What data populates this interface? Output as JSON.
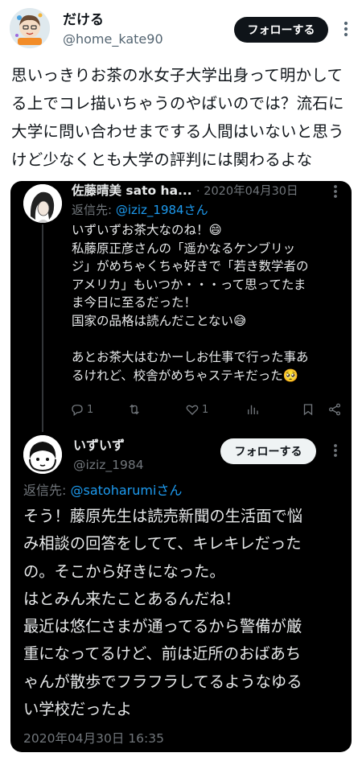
{
  "outer_tweet": {
    "author_name": "だける",
    "author_handle": "@home_kate90",
    "follow_label": "フォローする",
    "body": "思いっきりお茶の水女子大学出身って明かして\nる上でコレ描いちゃうのやばいのでは？流石に\n大学に問い合わせまでする人間はいないと思う\nけど少なくとも大学の評判には関わるよな"
  },
  "embedded_thread": {
    "first_reply": {
      "author_name": "佐藤晴美 sato ha...",
      "date": "· 2020年04月30日",
      "reply_prefix": "返信先: ",
      "reply_to": "@iziz_1984さん",
      "body": "いずいずお茶大なのね！😄\n私藤原正彦さんの「遥かなるケンブリッ\nジ」がめちゃくちゃ好きで「若き数学者の\nアメリカ」もいつか・・・って思ってたま\nま今日に至るだった！\n国家の品格は読んだことない😅\n\nあとお茶大はむかーしお仕事で行った事あ\nるけれど、校舎がめちゃステキだった🥺",
      "actions": {
        "reply_count": "1",
        "retweet_count": "",
        "like_count": "1"
      }
    },
    "second_reply": {
      "author_name": "いずいず",
      "author_handle": "@iziz_1984",
      "follow_label": "フォローする",
      "reply_prefix": "返信先: ",
      "reply_to": "@satoharumiさん",
      "body": "そう！藤原先生は読売新聞の生活面で悩\nみ相談の回答をしてて、キレキレだった\nの。そこから好きになった。\nはとみん来たことあるんだね！\n最近は悠仁さまが通ってるから警備が厳\n重になってるけど、前は近所のおばあち\nゃんが散歩でフラフラしてるようなゆる\nい学校だったよ",
      "timestamp": "2020年04月30日 16:35"
    }
  },
  "icons": [
    "more-icon",
    "reply-icon",
    "retweet-icon",
    "like-icon",
    "analytics-icon",
    "bookmark-icon",
    "share-icon"
  ]
}
